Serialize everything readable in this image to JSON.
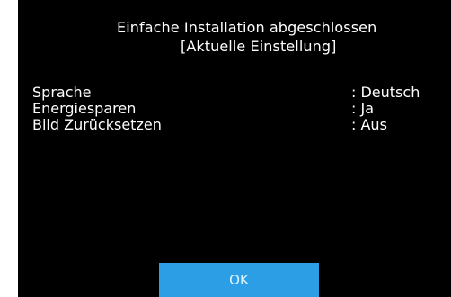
{
  "dialog": {
    "title": "Einfache Installation abgeschlossen",
    "subtitle": "[Aktuelle Einstellung]",
    "settings": [
      {
        "label": "Sprache",
        "value": ": Deutsch"
      },
      {
        "label": "Energiesparen",
        "value": ": Ja"
      },
      {
        "label": "Bild Zurücksetzen",
        "value": ": Aus"
      }
    ],
    "ok_label": "OK"
  },
  "colors": {
    "background": "#000000",
    "text": "#ffffff",
    "button": "#2b9ee6"
  }
}
